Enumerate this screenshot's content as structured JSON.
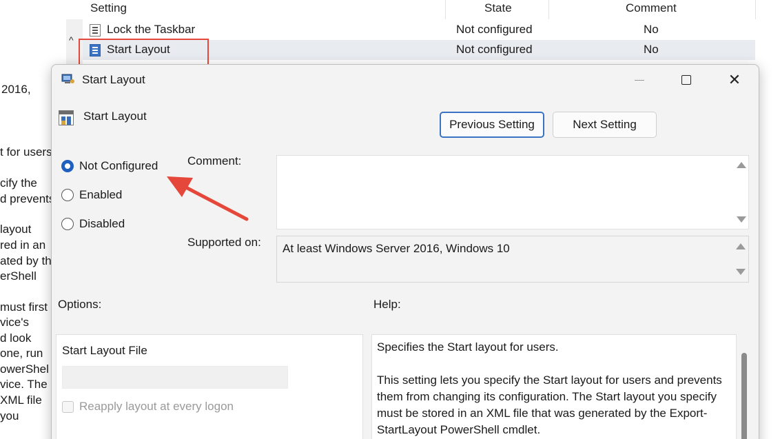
{
  "background": {
    "left_text_fragments": [
      "2016,",
      "t for users",
      "cify the",
      "d prevents",
      "layout",
      "red in an",
      "ated by th",
      "erShell",
      "must first",
      "vice's",
      "d look",
      "one, run",
      "owerShel",
      "vice. The",
      "XML file",
      "you"
    ],
    "columns": {
      "setting": "Setting",
      "state": "State",
      "comment": "Comment"
    },
    "rows": [
      {
        "name": "Lock the Taskbar",
        "state": "Not configured",
        "comment": "No"
      },
      {
        "name": "Start Layout",
        "state": "Not configured",
        "comment": "No"
      }
    ],
    "scroll_up_glyph": "^"
  },
  "dialog": {
    "title": "Start Layout",
    "policy_name": "Start Layout",
    "buttons": {
      "previous": "Previous Setting",
      "next": "Next Setting",
      "close_glyph": "✕"
    },
    "radios": [
      {
        "label": "Not Configured",
        "checked": true
      },
      {
        "label": "Enabled",
        "checked": false
      },
      {
        "label": "Disabled",
        "checked": false
      }
    ],
    "labels": {
      "comment": "Comment:",
      "supported_on": "Supported on:",
      "options": "Options:",
      "help": "Help:"
    },
    "comment_value": "",
    "supported_on_value": "At least Windows Server 2016, Windows 10",
    "options": {
      "start_layout_file_label": "Start Layout File",
      "start_layout_file_value": "",
      "reapply_label": "Reapply layout at every logon",
      "reapply_checked": false
    },
    "help_paragraphs": [
      "Specifies the Start layout for users.",
      "This setting lets you specify the Start layout for users and prevents them from changing its configuration. The Start layout you specify must be stored in an XML file that was generated by the Export-StartLayout PowerShell cmdlet."
    ]
  },
  "colors": {
    "annotation_red": "#e5483a",
    "accent_blue": "#1f5fbf"
  }
}
